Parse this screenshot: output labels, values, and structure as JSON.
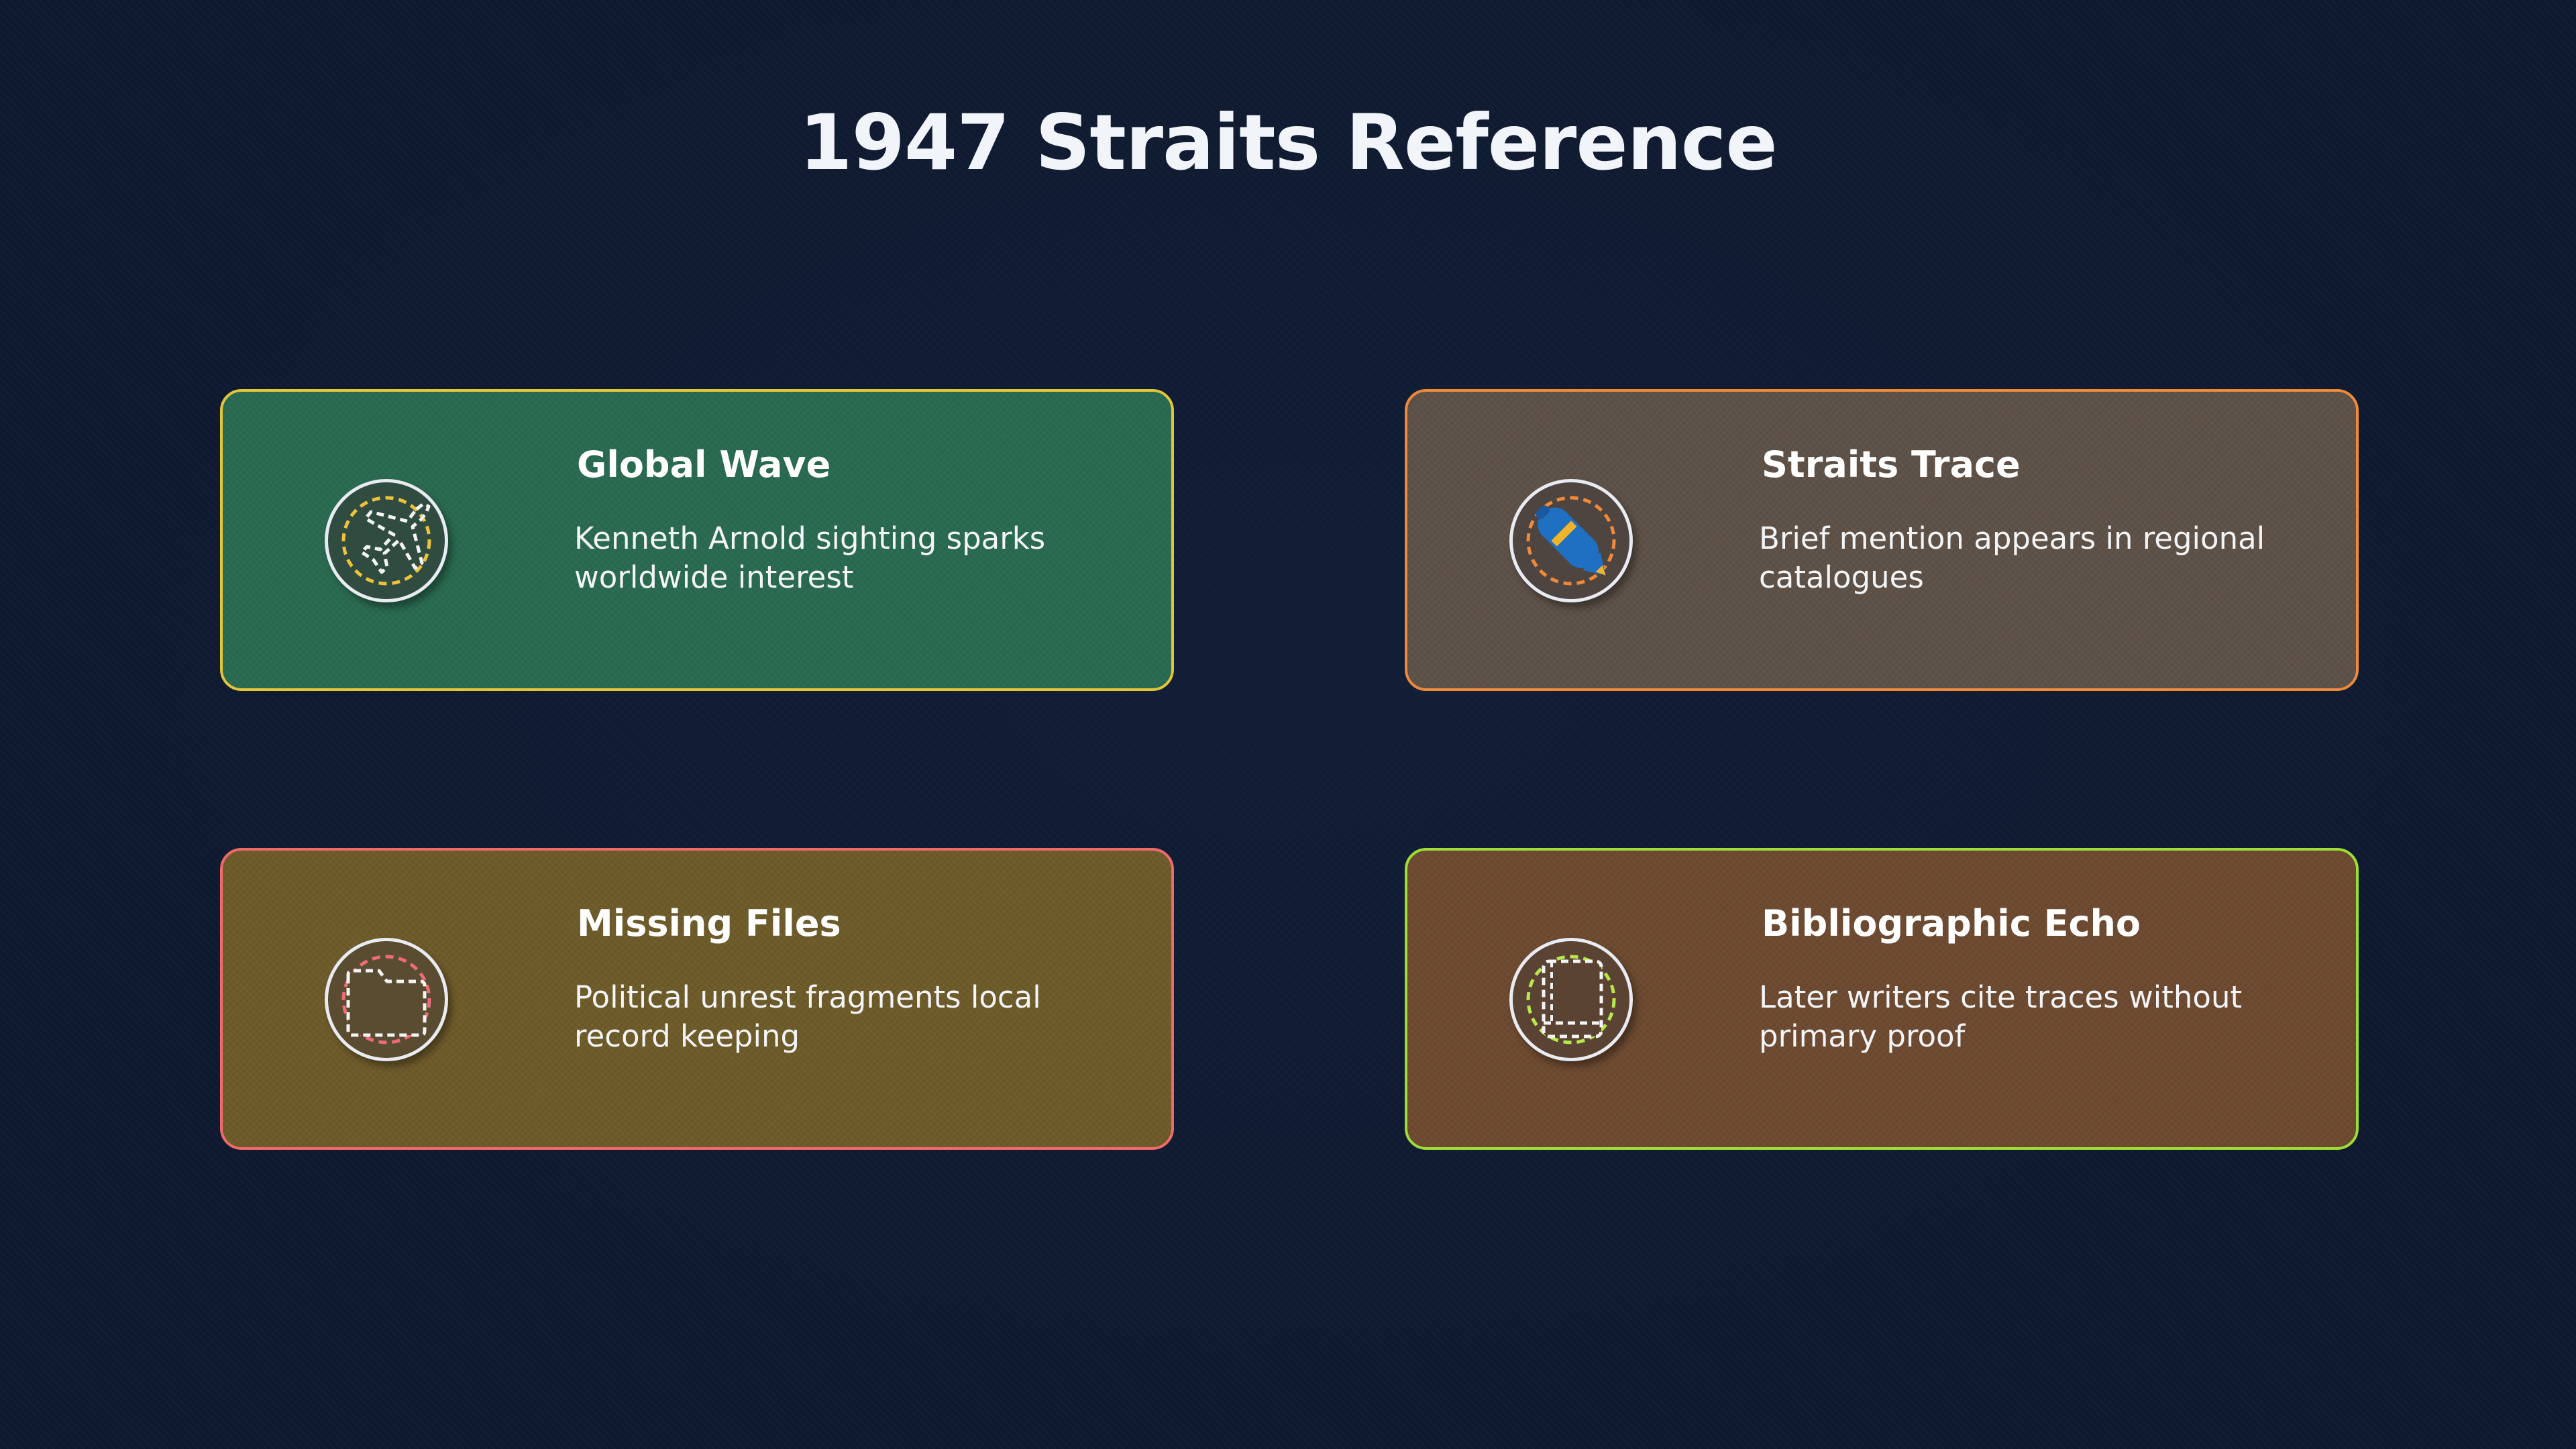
{
  "title": "1947 Straits Reference",
  "cards": [
    {
      "title": "Global Wave",
      "description": "Kenneth Arnold sighting sparks worldwide interest",
      "icon": "airplane-icon",
      "background": "#296a50",
      "border": "#e3c53a",
      "icon_bg": "#304c40",
      "icon_ring": "#f0c23a"
    },
    {
      "title": "Straits Trace",
      "description": "Brief mention appears in regional catalogues",
      "icon": "pen-icon",
      "background": "#5d5148",
      "border": "#f08a3a",
      "icon_bg": "#4e4540",
      "icon_ring": "#f08a3a"
    },
    {
      "title": "Missing Files",
      "description": "Political unrest fragments local record keeping",
      "icon": "folder-icon",
      "background": "#6e5b2a",
      "border": "#f06a6a",
      "icon_bg": "#5a4c30",
      "icon_ring": "#f06a7a"
    },
    {
      "title": "Bibliographic Echo",
      "description": "Later writers cite traces without primary proof",
      "icon": "book-icon",
      "background": "#6d4a30",
      "border": "#9edc36",
      "icon_bg": "#5a4332",
      "icon_ring": "#b6e84a"
    }
  ]
}
